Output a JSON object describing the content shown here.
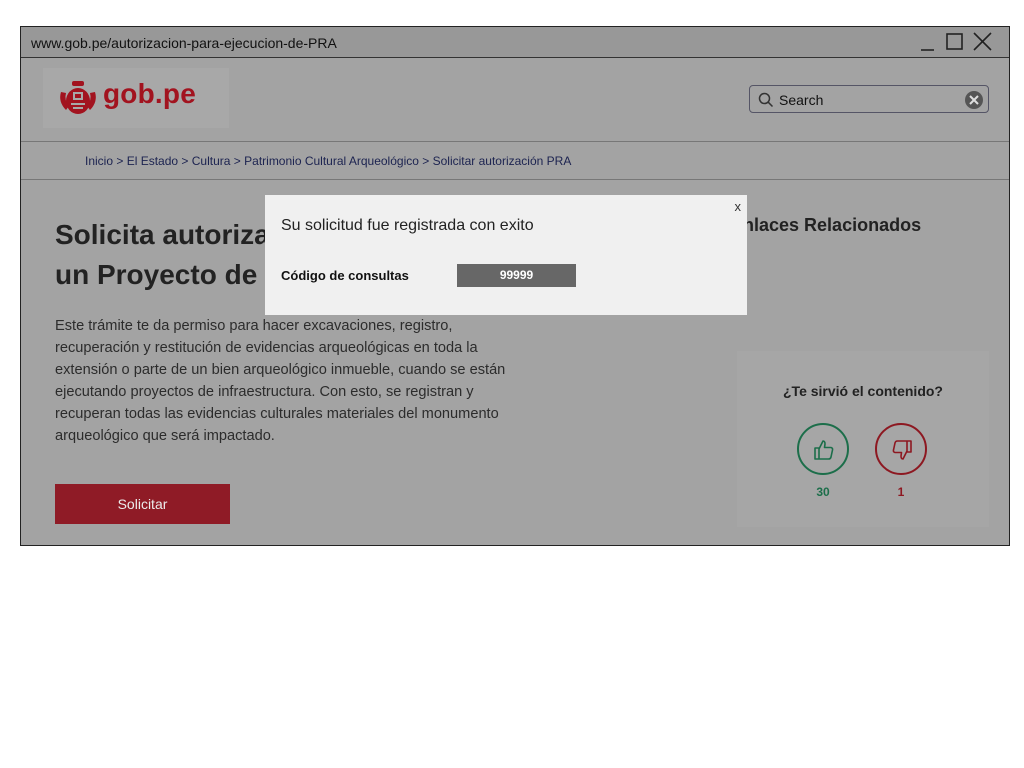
{
  "window": {
    "url": "www.gob.pe/autorizacion-para-ejecucion-de-PRA",
    "controls": [
      "minimize-icon",
      "maximize-icon",
      "close-icon"
    ]
  },
  "header": {
    "logo_text": "gob.pe",
    "logo_icon": "peru-coat-of-arms-icon",
    "search": {
      "placeholder": "Search",
      "icon": "search-icon",
      "clear_icon": "clear-icon"
    }
  },
  "breadcrumb": {
    "items": [
      "Inicio",
      "El Estado",
      "Cultura",
      "Patrimonio Cultural Arqueológico",
      "Solicitar autorización PRA"
    ],
    "separator": ">"
  },
  "main": {
    "title_line1": "Solicita autorización para la ejecución de",
    "title_line2": "un Proyecto de Rescate Arqueológico",
    "description": "Este trámite te da permiso para hacer excavaciones, registro, recuperación y restitución de evidencias arqueológicas en toda la extensión o parte de un bien arqueológico inmueble, cuando se están ejecutando proyectos de infraestructura. Con esto, se registran y recuperan todas las evidencias culturales materiales del monumento arqueológico que será impactado.",
    "cta_label": "Solicitar"
  },
  "sidebar": {
    "related_title": "Enlaces Relacionados",
    "feedback": {
      "question": "¿Te sirvió el contenido?",
      "up_count": "30",
      "down_count": "1",
      "up_icon": "thumbs-up-icon",
      "down_icon": "thumbs-down-icon"
    }
  },
  "modal": {
    "close_label": "x",
    "message": "Su solicitud fue registrada con exito",
    "code_label": "Código de consultas",
    "code_value": "99999"
  },
  "colors": {
    "brand_red": "#a2131f",
    "button_red": "#8f1b26",
    "positive_green": "#1c6e4a",
    "overlay_gray": "#a3a3a3",
    "modal_bg": "#f0f0f0"
  }
}
